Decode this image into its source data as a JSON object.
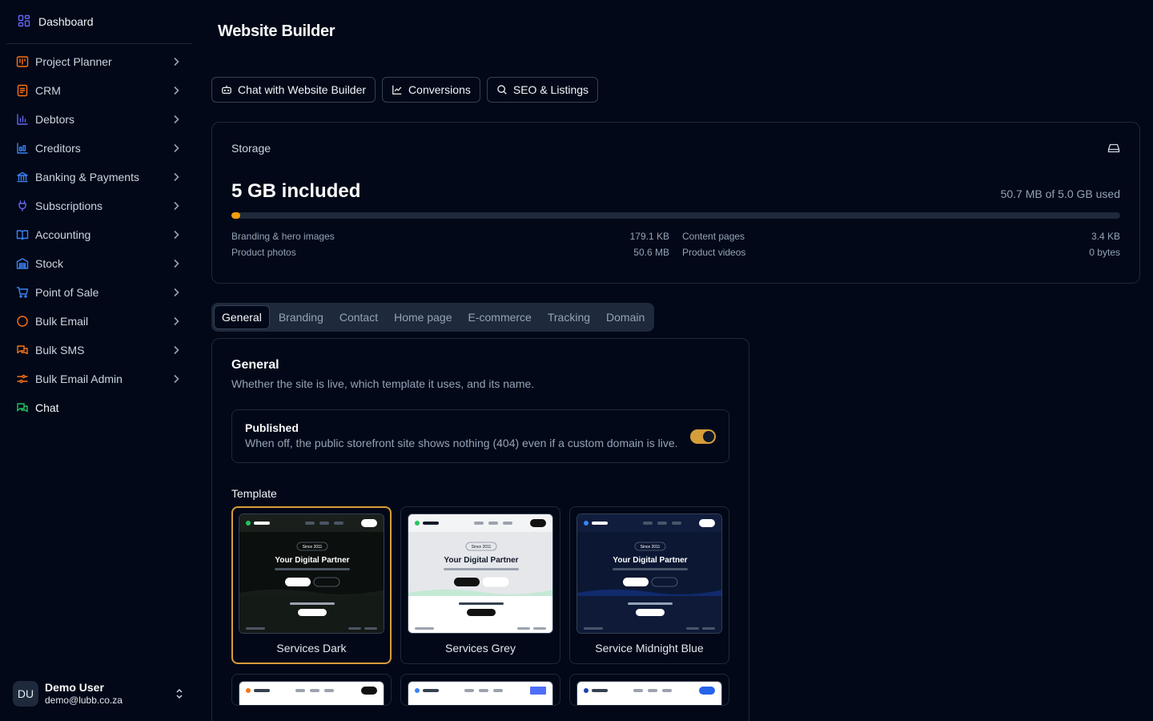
{
  "sidebar": {
    "top": {
      "label": "Dashboard"
    },
    "items": [
      {
        "label": "Project Planner",
        "icon": "kanban-icon",
        "color": "#f97316"
      },
      {
        "label": "CRM",
        "icon": "contact-card-icon",
        "color": "#f97316"
      },
      {
        "label": "Debtors",
        "icon": "bar-chart-icon",
        "color": "#6366f1"
      },
      {
        "label": "Creditors",
        "icon": "line-chart-icon",
        "color": "#3b82f6"
      },
      {
        "label": "Banking & Payments",
        "icon": "bank-icon",
        "color": "#3b82f6"
      },
      {
        "label": "Subscriptions",
        "icon": "plug-icon",
        "color": "#6366f1"
      },
      {
        "label": "Accounting",
        "icon": "book-icon",
        "color": "#3b82f6"
      },
      {
        "label": "Stock",
        "icon": "warehouse-icon",
        "color": "#3b82f6"
      },
      {
        "label": "Point of Sale",
        "icon": "cart-icon",
        "color": "#3b82f6"
      },
      {
        "label": "Bulk Email",
        "icon": "circle-icon",
        "color": "#f97316"
      },
      {
        "label": "Bulk SMS",
        "icon": "messages-icon",
        "color": "#f97316"
      },
      {
        "label": "Bulk Email Admin",
        "icon": "sliders-icon",
        "color": "#f97316"
      }
    ],
    "chat": {
      "label": "Chat",
      "color": "#22c55e"
    },
    "user": {
      "initials": "DU",
      "name": "Demo User",
      "email": "demo@lubb.co.za"
    }
  },
  "header": {
    "title": "Website Builder"
  },
  "toolbar": {
    "chat_label": "Chat with Website Builder",
    "conversions_label": "Conversions",
    "seo_label": "SEO & Listings"
  },
  "storage": {
    "title": "Storage",
    "included": "5 GB included",
    "used_text": "50.7 MB of 5.0 GB used",
    "used_fraction": 0.0099,
    "accent": "#f59e0b",
    "breakdown": [
      {
        "label": "Branding & hero images",
        "value": "179.1 KB"
      },
      {
        "label": "Content pages",
        "value": "3.4 KB"
      },
      {
        "label": "Product photos",
        "value": "50.6 MB"
      },
      {
        "label": "Product videos",
        "value": "0 bytes"
      }
    ]
  },
  "tabs": [
    "General",
    "Branding",
    "Contact",
    "Home page",
    "E-commerce",
    "Tracking",
    "Domain"
  ],
  "general": {
    "title": "General",
    "subtitle": "Whether the site is live, which template it uses, and its name.",
    "published": {
      "title": "Published",
      "description": "When off, the public storefront site shows nothing (404) even if a custom domain is live.",
      "on": true
    },
    "template_label": "Template",
    "thumb_badge": "Since 2011",
    "thumb_heading": "Your Digital Partner",
    "templates": [
      {
        "name": "Services Dark",
        "selected": true
      },
      {
        "name": "Services Grey",
        "selected": false
      },
      {
        "name": "Service Midnight Blue",
        "selected": false
      }
    ]
  }
}
